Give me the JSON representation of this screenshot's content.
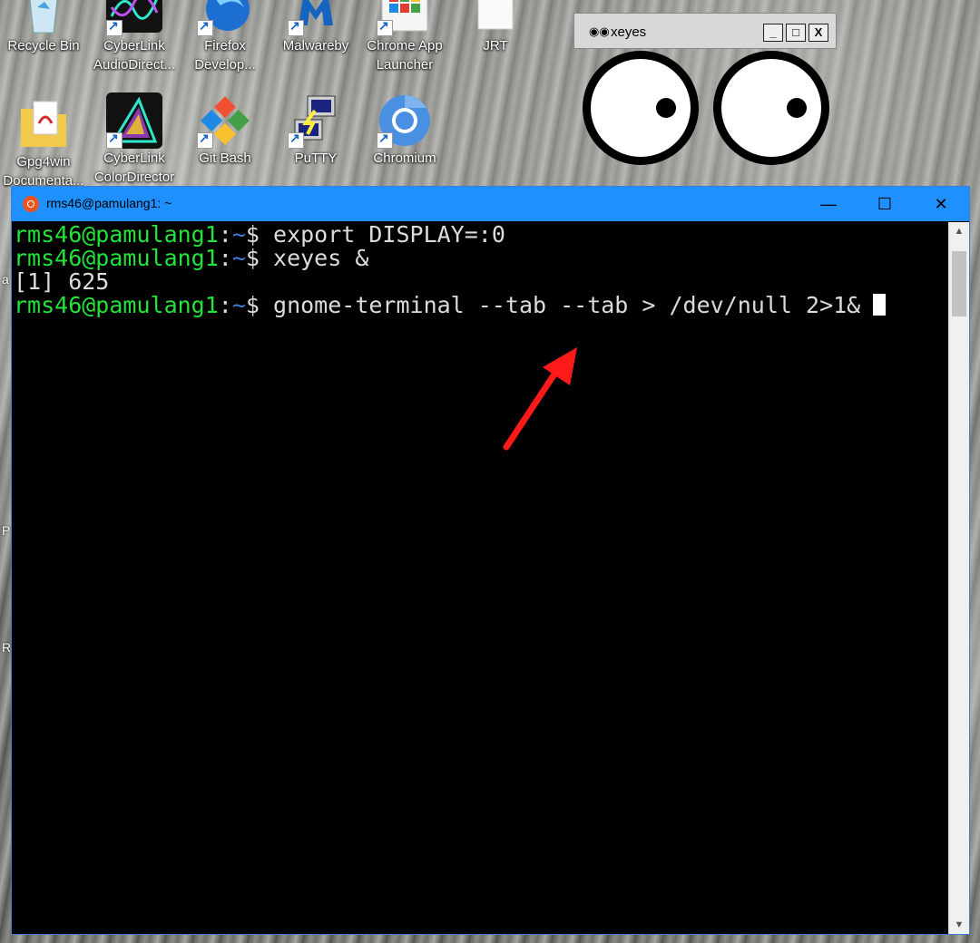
{
  "desktop": {
    "icons_row1": [
      {
        "label1": "Recycle Bin",
        "label2": "",
        "icon": "recycle-bin-icon"
      },
      {
        "label1": "CyberLink",
        "label2": "AudioDirect...",
        "icon": "cyberlink-audiodirector-icon"
      },
      {
        "label1": "Firefox",
        "label2": "Develop...",
        "icon": "firefox-developer-icon"
      },
      {
        "label1": "Malwareby",
        "label2": "",
        "icon": "malwarebytes-icon"
      },
      {
        "label1": "Chrome App",
        "label2": "Launcher",
        "icon": "chrome-app-launcher-icon"
      },
      {
        "label1": "JRT",
        "label2": "",
        "icon": "jrt-file-icon"
      }
    ],
    "icons_row2": [
      {
        "label1": "Gpg4win",
        "label2": "Documenta...",
        "icon": "gpg4win-documentation-icon"
      },
      {
        "label1": "CyberLink",
        "label2": "ColorDirector",
        "icon": "cyberlink-colordirector-icon"
      },
      {
        "label1": "Git Bash",
        "label2": "",
        "icon": "git-bash-icon"
      },
      {
        "label1": "PuTTY",
        "label2": "",
        "icon": "putty-icon"
      },
      {
        "label1": "Chromium",
        "label2": "",
        "icon": "chromium-icon"
      }
    ],
    "edge_letters": [
      "a",
      "P",
      "R"
    ]
  },
  "xeyes": {
    "title": "xeyes",
    "controls": {
      "minimize": "_",
      "maximize": "□",
      "close": "X"
    }
  },
  "terminal": {
    "title": "rms46@pamulang1: ~",
    "controls": {
      "minimize": "—",
      "maximize": "☐",
      "close": "✕"
    },
    "lines": [
      {
        "user": "rms46@pamulang1",
        "sep": ":",
        "path": "~",
        "prompt": "$ ",
        "cmd": "export DISPLAY=:0"
      },
      {
        "user": "rms46@pamulang1",
        "sep": ":",
        "path": "~",
        "prompt": "$ ",
        "cmd": "xeyes &"
      },
      {
        "output": "[1] 625"
      },
      {
        "user": "rms46@pamulang1",
        "sep": ":",
        "path": "~",
        "prompt": "$ ",
        "cmd": "gnome-terminal --tab --tab > /dev/null 2>1&"
      }
    ]
  },
  "colors": {
    "prompt_user": "#22e33a",
    "prompt_path": "#3f7fe0",
    "annotation_arrow": "#ff1a1a",
    "titlebar": "#1e90ff"
  }
}
